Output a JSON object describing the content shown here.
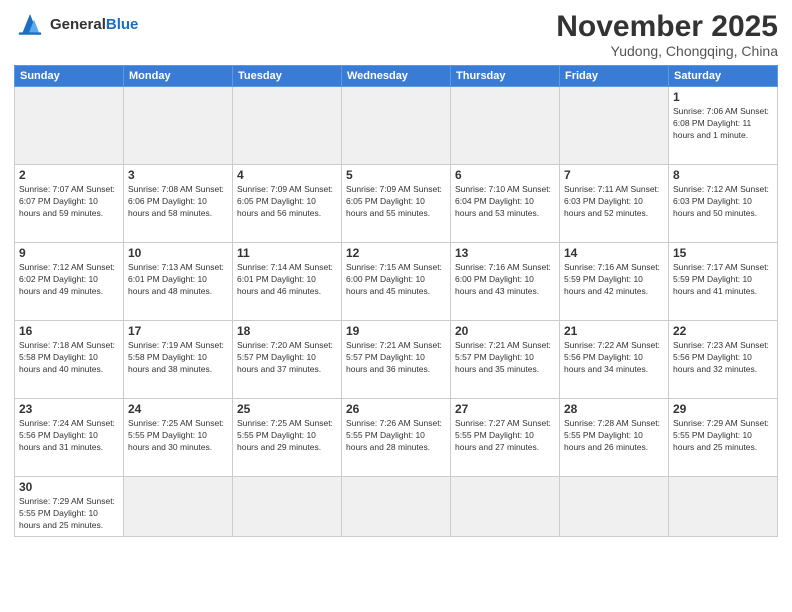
{
  "header": {
    "logo_general": "General",
    "logo_blue": "Blue",
    "month_title": "November 2025",
    "subtitle": "Yudong, Chongqing, China"
  },
  "days_of_week": [
    "Sunday",
    "Monday",
    "Tuesday",
    "Wednesday",
    "Thursday",
    "Friday",
    "Saturday"
  ],
  "weeks": [
    [
      {
        "day": "",
        "info": ""
      },
      {
        "day": "",
        "info": ""
      },
      {
        "day": "",
        "info": ""
      },
      {
        "day": "",
        "info": ""
      },
      {
        "day": "",
        "info": ""
      },
      {
        "day": "",
        "info": ""
      },
      {
        "day": "1",
        "info": "Sunrise: 7:06 AM\nSunset: 6:08 PM\nDaylight: 11 hours\nand 1 minute."
      }
    ],
    [
      {
        "day": "2",
        "info": "Sunrise: 7:07 AM\nSunset: 6:07 PM\nDaylight: 10 hours\nand 59 minutes."
      },
      {
        "day": "3",
        "info": "Sunrise: 7:08 AM\nSunset: 6:06 PM\nDaylight: 10 hours\nand 58 minutes."
      },
      {
        "day": "4",
        "info": "Sunrise: 7:09 AM\nSunset: 6:05 PM\nDaylight: 10 hours\nand 56 minutes."
      },
      {
        "day": "5",
        "info": "Sunrise: 7:09 AM\nSunset: 6:05 PM\nDaylight: 10 hours\nand 55 minutes."
      },
      {
        "day": "6",
        "info": "Sunrise: 7:10 AM\nSunset: 6:04 PM\nDaylight: 10 hours\nand 53 minutes."
      },
      {
        "day": "7",
        "info": "Sunrise: 7:11 AM\nSunset: 6:03 PM\nDaylight: 10 hours\nand 52 minutes."
      },
      {
        "day": "8",
        "info": "Sunrise: 7:12 AM\nSunset: 6:03 PM\nDaylight: 10 hours\nand 50 minutes."
      }
    ],
    [
      {
        "day": "9",
        "info": "Sunrise: 7:12 AM\nSunset: 6:02 PM\nDaylight: 10 hours\nand 49 minutes."
      },
      {
        "day": "10",
        "info": "Sunrise: 7:13 AM\nSunset: 6:01 PM\nDaylight: 10 hours\nand 48 minutes."
      },
      {
        "day": "11",
        "info": "Sunrise: 7:14 AM\nSunset: 6:01 PM\nDaylight: 10 hours\nand 46 minutes."
      },
      {
        "day": "12",
        "info": "Sunrise: 7:15 AM\nSunset: 6:00 PM\nDaylight: 10 hours\nand 45 minutes."
      },
      {
        "day": "13",
        "info": "Sunrise: 7:16 AM\nSunset: 6:00 PM\nDaylight: 10 hours\nand 43 minutes."
      },
      {
        "day": "14",
        "info": "Sunrise: 7:16 AM\nSunset: 5:59 PM\nDaylight: 10 hours\nand 42 minutes."
      },
      {
        "day": "15",
        "info": "Sunrise: 7:17 AM\nSunset: 5:59 PM\nDaylight: 10 hours\nand 41 minutes."
      }
    ],
    [
      {
        "day": "16",
        "info": "Sunrise: 7:18 AM\nSunset: 5:58 PM\nDaylight: 10 hours\nand 40 minutes."
      },
      {
        "day": "17",
        "info": "Sunrise: 7:19 AM\nSunset: 5:58 PM\nDaylight: 10 hours\nand 38 minutes."
      },
      {
        "day": "18",
        "info": "Sunrise: 7:20 AM\nSunset: 5:57 PM\nDaylight: 10 hours\nand 37 minutes."
      },
      {
        "day": "19",
        "info": "Sunrise: 7:21 AM\nSunset: 5:57 PM\nDaylight: 10 hours\nand 36 minutes."
      },
      {
        "day": "20",
        "info": "Sunrise: 7:21 AM\nSunset: 5:57 PM\nDaylight: 10 hours\nand 35 minutes."
      },
      {
        "day": "21",
        "info": "Sunrise: 7:22 AM\nSunset: 5:56 PM\nDaylight: 10 hours\nand 34 minutes."
      },
      {
        "day": "22",
        "info": "Sunrise: 7:23 AM\nSunset: 5:56 PM\nDaylight: 10 hours\nand 32 minutes."
      }
    ],
    [
      {
        "day": "23",
        "info": "Sunrise: 7:24 AM\nSunset: 5:56 PM\nDaylight: 10 hours\nand 31 minutes."
      },
      {
        "day": "24",
        "info": "Sunrise: 7:25 AM\nSunset: 5:55 PM\nDaylight: 10 hours\nand 30 minutes."
      },
      {
        "day": "25",
        "info": "Sunrise: 7:25 AM\nSunset: 5:55 PM\nDaylight: 10 hours\nand 29 minutes."
      },
      {
        "day": "26",
        "info": "Sunrise: 7:26 AM\nSunset: 5:55 PM\nDaylight: 10 hours\nand 28 minutes."
      },
      {
        "day": "27",
        "info": "Sunrise: 7:27 AM\nSunset: 5:55 PM\nDaylight: 10 hours\nand 27 minutes."
      },
      {
        "day": "28",
        "info": "Sunrise: 7:28 AM\nSunset: 5:55 PM\nDaylight: 10 hours\nand 26 minutes."
      },
      {
        "day": "29",
        "info": "Sunrise: 7:29 AM\nSunset: 5:55 PM\nDaylight: 10 hours\nand 25 minutes."
      }
    ],
    [
      {
        "day": "30",
        "info": "Sunrise: 7:29 AM\nSunset: 5:55 PM\nDaylight: 10 hours\nand 25 minutes."
      },
      {
        "day": "",
        "info": ""
      },
      {
        "day": "",
        "info": ""
      },
      {
        "day": "",
        "info": ""
      },
      {
        "day": "",
        "info": ""
      },
      {
        "day": "",
        "info": ""
      },
      {
        "day": "",
        "info": ""
      }
    ]
  ]
}
